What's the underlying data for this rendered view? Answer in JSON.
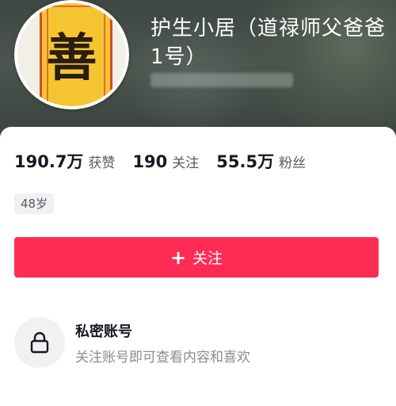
{
  "profile": {
    "name": "护生小居（道禄师父爸爸1号）",
    "avatar_glyph": "善"
  },
  "stats": {
    "likes_value": "190.7万",
    "likes_label": "获赞",
    "following_value": "190",
    "following_label": "关注",
    "followers_value": "55.5万",
    "followers_label": "粉丝"
  },
  "tags": {
    "age": "48岁"
  },
  "actions": {
    "follow_label": "关注",
    "follow_icon": "plus-icon"
  },
  "private": {
    "title": "私密账号",
    "description": "关注账号即可查看内容和喜欢",
    "icon": "lock-icon"
  },
  "colors": {
    "accent": "#fe2c55",
    "text_primary": "#161823",
    "text_secondary": "#8a8b91"
  }
}
